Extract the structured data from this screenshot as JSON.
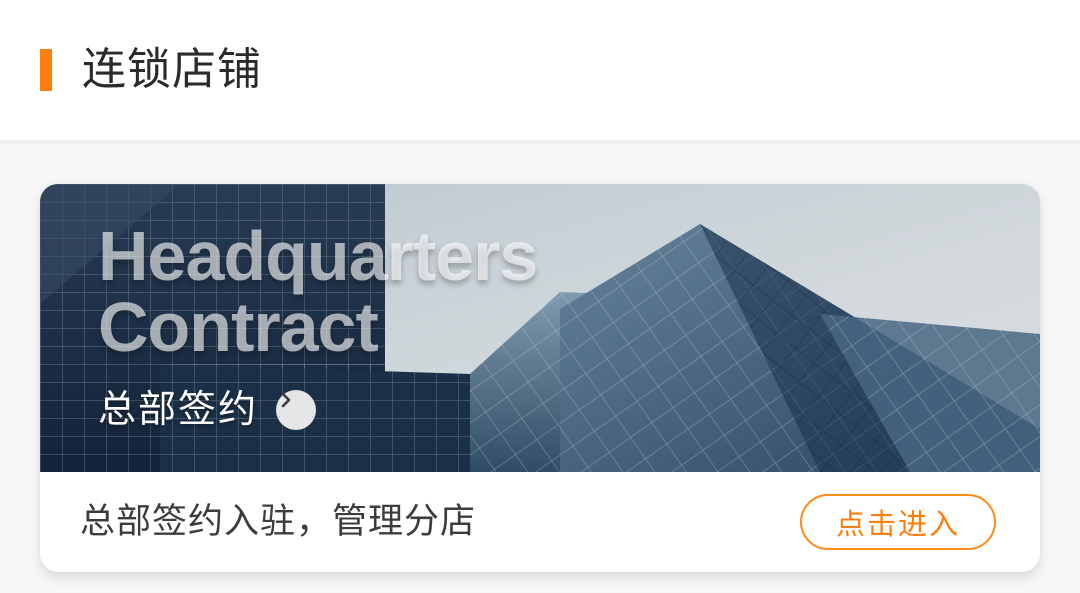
{
  "header": {
    "title": "连锁店铺"
  },
  "colors": {
    "accent": "#ff7f0e",
    "banner_dark": "#1f3550",
    "banner_sky": "#dfe7ea"
  },
  "card": {
    "banner": {
      "title_en_line1": "Headquarters",
      "title_en_line2": "Contract",
      "title_cn": "总部签约",
      "arrow_icon": "chevron-right-icon"
    },
    "description": "总部签约入驻，管理分店",
    "enter_label": "点击进入"
  }
}
